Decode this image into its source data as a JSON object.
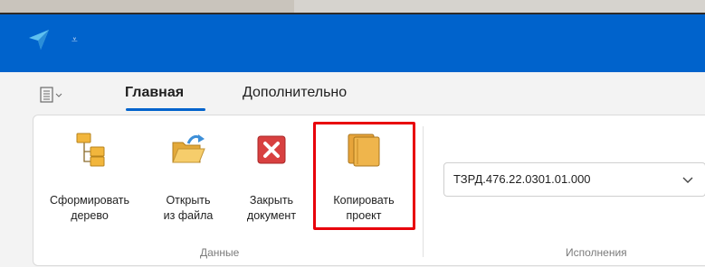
{
  "titlebar": {
    "qat_dropdown": "⩡"
  },
  "tabs": [
    {
      "label": "Главная",
      "active": true
    },
    {
      "label": "Дополнительно",
      "active": false
    }
  ],
  "ribbon": {
    "groups": [
      {
        "label": "Данные",
        "buttons": [
          {
            "label": "Сформировать\nдерево",
            "icon": "tree-structure-icon"
          },
          {
            "label": "Открыть\nиз файла",
            "icon": "open-folder-icon"
          },
          {
            "label": "Закрыть\nдокумент",
            "icon": "close-red-x-icon"
          },
          {
            "label": "Копировать\nпроект",
            "icon": "copy-project-icon",
            "highlighted": true
          }
        ]
      },
      {
        "label": "Исполнения",
        "combo": {
          "value": "ТЗРД.476.22.0301.01.000"
        }
      }
    ]
  },
  "colors": {
    "titlebar": "#0063cc",
    "accent": "#0063cc",
    "highlight": "#e8000b"
  }
}
